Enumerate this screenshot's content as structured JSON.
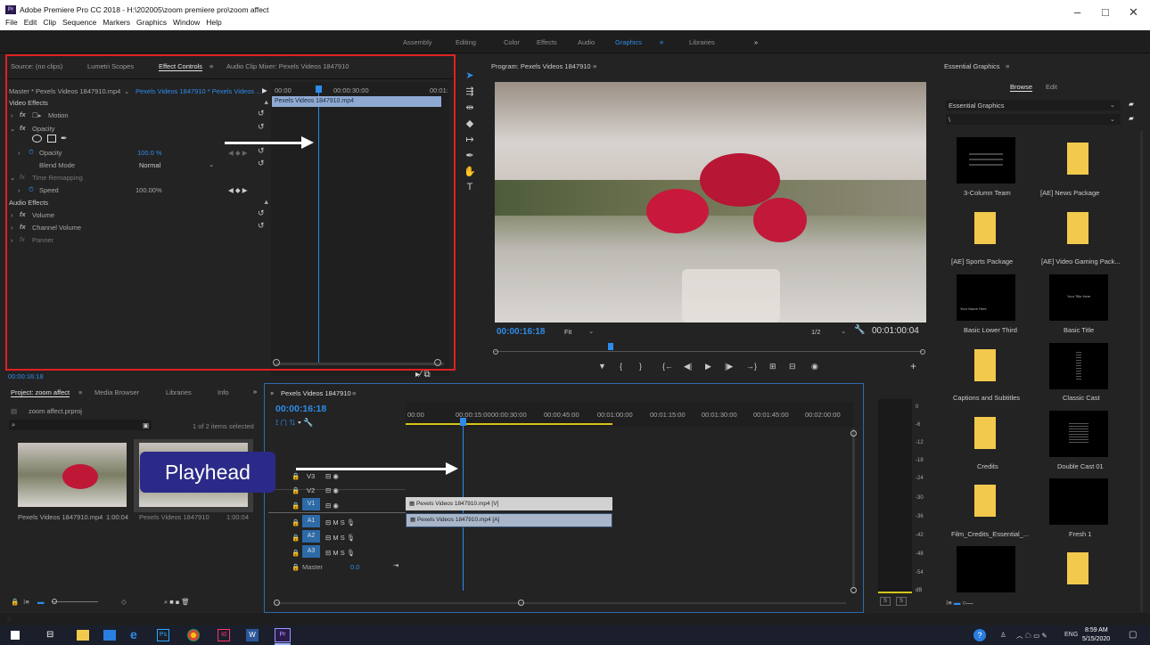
{
  "window": {
    "title": "Adobe Premiere Pro CC 2018 - H:\\202005\\zoom premiere pro\\zoom affect",
    "app_badge": "Pr",
    "min_glyph": "–",
    "max_glyph": "□",
    "close_glyph": "✕"
  },
  "menu": [
    "File",
    "Edit",
    "Clip",
    "Sequence",
    "Markers",
    "Graphics",
    "Window",
    "Help"
  ],
  "workspaces": [
    "Assembly",
    "Editing",
    "Color",
    "Effects",
    "Audio",
    "Graphics",
    "Libraries"
  ],
  "workspace_more": "»",
  "workspace_menu": "≡",
  "source_panel": {
    "tabs": [
      "Source: (no clips)",
      "Lumetri Scopes",
      "Effect Controls",
      "Audio Clip Mixer: Pexels Videos 1847910"
    ],
    "tab_menu": "≡"
  },
  "effect_controls": {
    "master": "Master * Pexels Videos 1847910.mp4",
    "sequence_clip": "Pexels Videos 1847910 * Pexels Videos ...",
    "ruler": [
      "00:00",
      "00:00:30:00",
      "00:01:"
    ],
    "clip_bar": "Pexels Videos 1847910.mp4",
    "video_effects": "Video Effects",
    "motion": "Motion",
    "opacity_group": "Opacity",
    "opacity_label": "Opacity",
    "opacity_value": "100.0 %",
    "blend_label": "Blend Mode",
    "blend_value": "Normal",
    "time_remap": "Time Remapping",
    "speed_label": "Speed",
    "speed_value": "100.00%",
    "audio_effects": "Audio Effects",
    "volume": "Volume",
    "channel_volume": "Channel Volume",
    "panner": "Panner",
    "timecode": "00:00:16:18"
  },
  "program": {
    "title": "Program: Pexels Videos 1847910",
    "timecode": "00:00:16:18",
    "fit": "Fit",
    "resolution": "1/2",
    "duration": "00:01:00:04",
    "menu": "≡"
  },
  "essential_graphics": {
    "title": "Essential Graphics",
    "tabs": [
      "Browse",
      "Edit"
    ],
    "dropdown": "Essential Graphics",
    "path": "\\",
    "items": [
      "3-Column Team",
      "[AE] News Package",
      "[AE] Sports Package",
      "[AE] Video Gaming Pack...",
      "Basic Lower Third",
      "Basic Title",
      "Captions and Subtitles",
      "Classic Cast",
      "Credits",
      "Double Cast 01",
      "Film_Credits_Essential_...",
      "Fresh 1"
    ],
    "thumb_texts": {
      "lower_third": "Your Name Here",
      "basic_title": "Your Title Here"
    }
  },
  "project": {
    "tabs": [
      "Project: zoom affect",
      "Media Browser",
      "Libraries",
      "Info"
    ],
    "tab_menu": "≡",
    "tab_more": "»",
    "file": "zoom affect.prproj",
    "count": "1 of 2 items selected",
    "clips": [
      {
        "name": "Pexels Videos 1847910.mp4",
        "dur": "1:00:04"
      },
      {
        "name": "Pexels Videos 1847910",
        "dur": "1:00:04"
      }
    ]
  },
  "timeline": {
    "tab": "Pexels Videos 1847910",
    "tab_menu": "≡",
    "tab_close": "×",
    "timecode": "00:00:16:18",
    "ruler": [
      "00:00",
      "00:00:15:00",
      "00:00:30:00",
      "00:00:45:00",
      "00:01:00:00",
      "00:01:15:00",
      "00:01:30:00",
      "00:01:45:00",
      "00:02:00:00"
    ],
    "video_tracks": [
      "V3",
      "V2",
      "V1"
    ],
    "audio_tracks": [
      "A1",
      "A2",
      "A3"
    ],
    "master": "Master",
    "master_val": "0.0",
    "v_clip": "Pexels Videos 1847910.mp4 [V]",
    "a_clip": "Pexels Videos 1847910.mp4 [A]",
    "ms": "M",
    "ss": "S"
  },
  "meter": {
    "scale": [
      "0",
      "-6",
      "-12",
      "-18",
      "-24",
      "-30",
      "-36",
      "-42",
      "-48",
      "-54",
      "dB"
    ],
    "s": "S"
  },
  "annotation": {
    "label": "Playhead"
  },
  "taskbar": {
    "time": "8:59 AM",
    "date": "5/15/2020",
    "lang": "ENG",
    "ps": "Ps",
    "id": "Id",
    "pr": "Pr"
  },
  "colors": {
    "accent": "#2d8ceb",
    "red_box": "#e02020",
    "annotation_bg": "#2b2a88",
    "video_clip": "#d1d1d1",
    "audio_clip": "#a9b6c9"
  }
}
